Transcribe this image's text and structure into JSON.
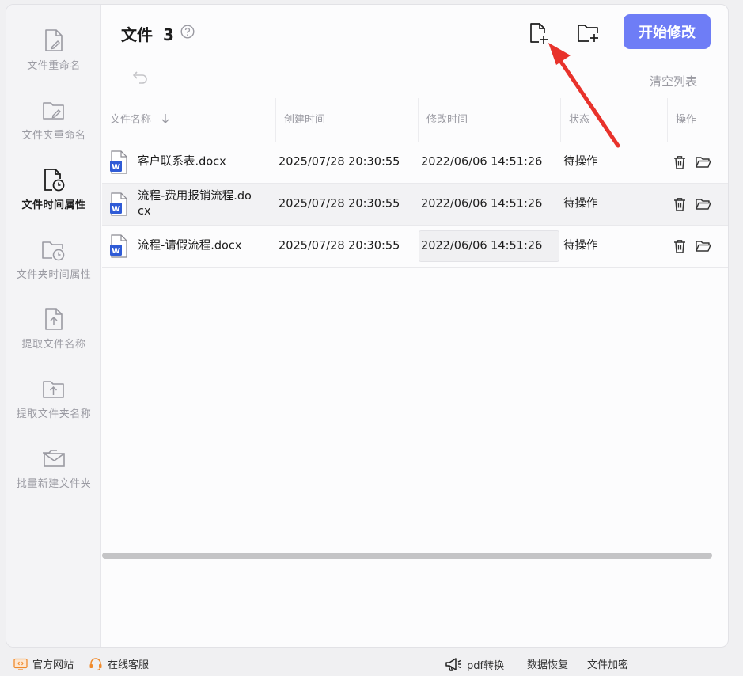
{
  "sidebar": {
    "items": [
      {
        "label": "文件重命名",
        "icon": "file-edit-icon",
        "active": false
      },
      {
        "label": "文件夹重命名",
        "icon": "folder-edit-icon",
        "active": false
      },
      {
        "label": "文件时间属性",
        "icon": "file-clock-icon",
        "active": true
      },
      {
        "label": "文件夹时间属性",
        "icon": "folder-clock-icon",
        "active": false
      },
      {
        "label": "提取文件名称",
        "icon": "file-upload-icon",
        "active": false
      },
      {
        "label": "提取文件夹名称",
        "icon": "folder-upload-icon",
        "active": false
      },
      {
        "label": "批量新建文件夹",
        "icon": "folder-mail-icon",
        "active": false
      }
    ]
  },
  "header": {
    "title": "文件",
    "count": "3",
    "start_button": "开始修改",
    "clear_list": "清空列表"
  },
  "table": {
    "columns": [
      "文件名称",
      "创建时间",
      "修改时间",
      "状态",
      "操作"
    ],
    "rows": [
      {
        "name": "客户联系表.docx",
        "created": "2025/07/28 20:30:55",
        "modified": "2022/06/06 14:51:26",
        "status": "待操作"
      },
      {
        "name": "流程-费用报销流程.docx",
        "name_line1": "流程-费用报销流程.do",
        "name_line2": "cx",
        "created": "2025/07/28 20:30:55",
        "modified": "2022/06/06 14:51:26",
        "status": "待操作"
      },
      {
        "name": "流程-请假流程.docx",
        "created": "2025/07/28 20:30:55",
        "modified": "2022/06/06 14:51:26",
        "status": "待操作"
      }
    ]
  },
  "statusbar": {
    "official_site": "官方网站",
    "online_service": "在线客服",
    "pdf_convert": "pdf转换",
    "data_recovery": "数据恢复",
    "file_encrypt": "文件加密"
  },
  "colors": {
    "accent": "#6e7df6",
    "word_blue": "#2f5bd6",
    "arrow_red": "#e8322b",
    "muted_text": "#9a9aa2"
  }
}
